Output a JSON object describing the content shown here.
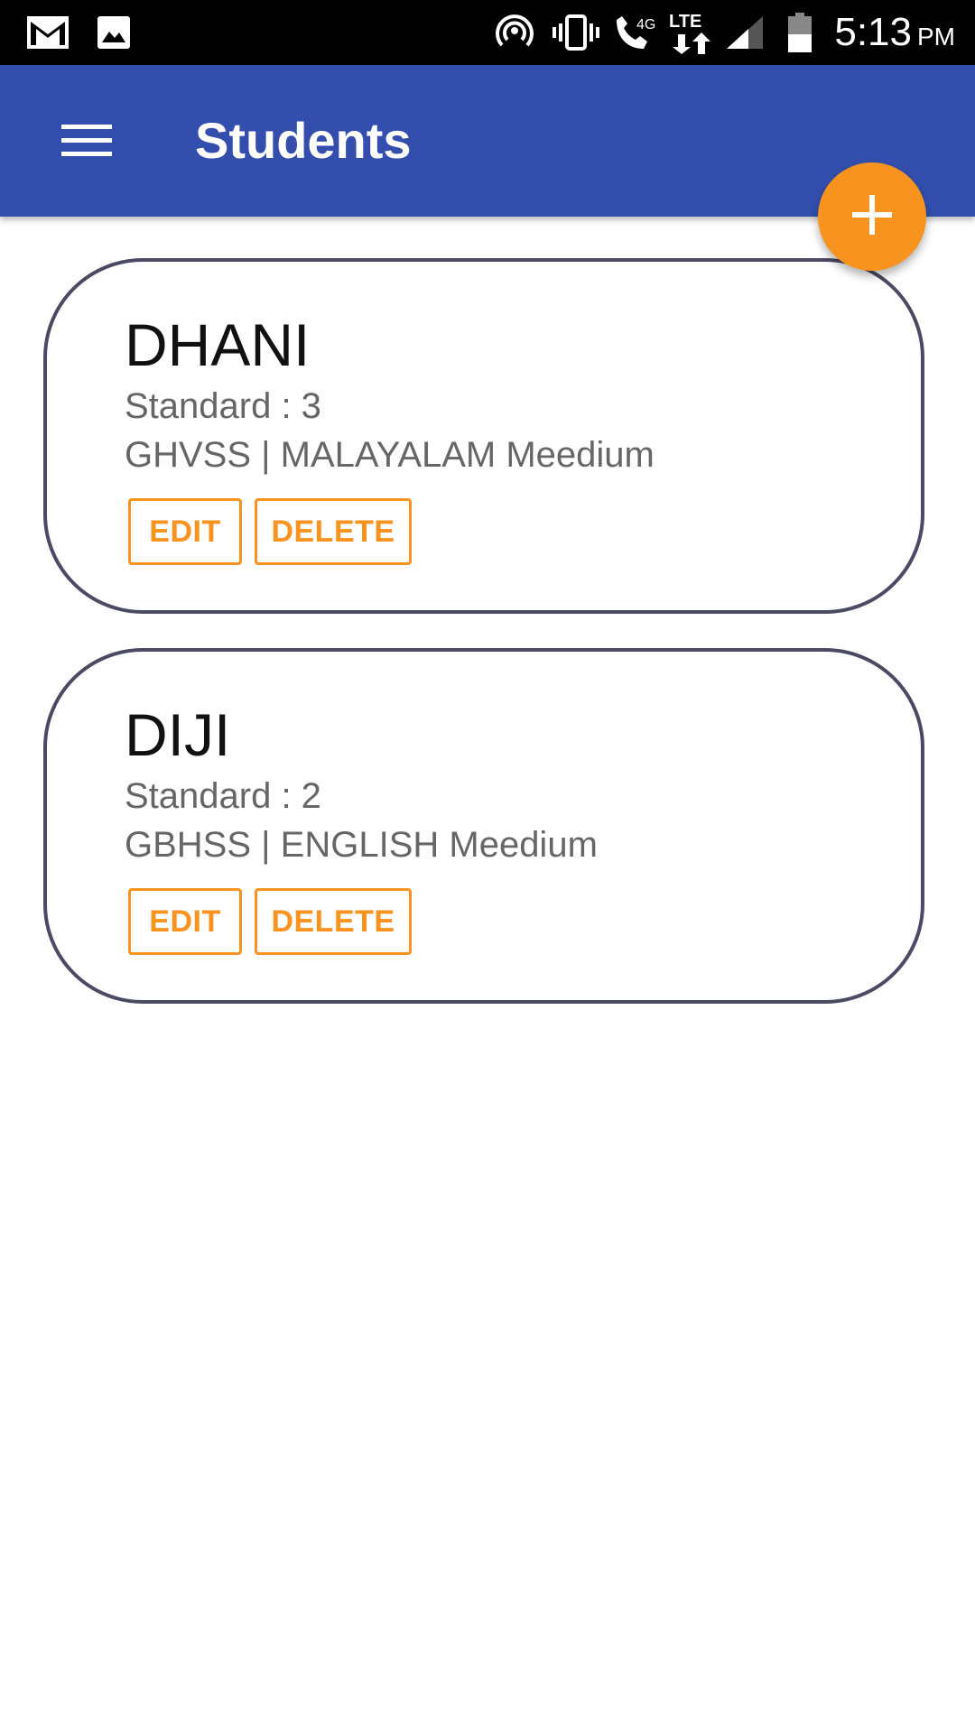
{
  "status_bar": {
    "time": "5:13",
    "ampm": "PM",
    "network_label": "4G",
    "lte_label": "LTE",
    "icons": [
      "gmail-icon",
      "image-icon",
      "hotspot-icon",
      "vibrate-icon",
      "wifi-calling-icon",
      "lte-data-icon",
      "signal-icon",
      "battery-icon"
    ]
  },
  "app_bar": {
    "title": "Students",
    "menu_icon": "hamburger-menu-icon"
  },
  "fab": {
    "icon": "plus-icon"
  },
  "students": [
    {
      "name": "DHANI",
      "standard": "Standard : 3",
      "school": "GHVSS | MALAYALAM Meedium",
      "edit_label": "EDIT",
      "delete_label": "DELETE"
    },
    {
      "name": "DIJI",
      "standard": "Standard : 2",
      "school": "GBHSS | ENGLISH Meedium",
      "edit_label": "EDIT",
      "delete_label": "DELETE"
    }
  ],
  "colors": {
    "status_bar": "#000000",
    "app_bar": "#334eac",
    "accent": "#f7931e",
    "card_border": "#4a4a62",
    "secondary_text": "#666666"
  }
}
